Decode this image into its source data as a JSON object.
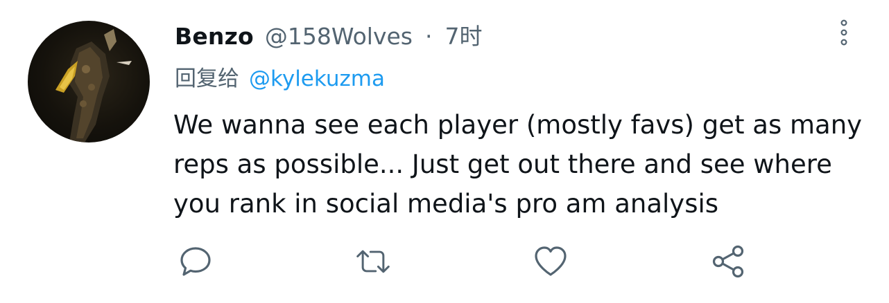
{
  "tweet": {
    "display_name": "Benzo",
    "handle": "@158Wolves",
    "separator": "·",
    "time": "7时",
    "reply_prefix": "回复给",
    "reply_target": "@kylekuzma",
    "body_lines": [
      "We wanna see each player (mostly favs) get as many",
      "reps as possible... Just get out there and see where",
      "you rank in social media's pro am analysis"
    ],
    "more_icon": "more-vertical-icon"
  },
  "actions": [
    {
      "name": "reply",
      "icon": "comment-icon"
    },
    {
      "name": "retweet",
      "icon": "retweet-icon"
    },
    {
      "name": "like",
      "icon": "heart-icon"
    },
    {
      "name": "share",
      "icon": "share-icon"
    }
  ],
  "colors": {
    "text": "#0f1419",
    "secondary": "#536471",
    "link": "#1d9bf0"
  }
}
